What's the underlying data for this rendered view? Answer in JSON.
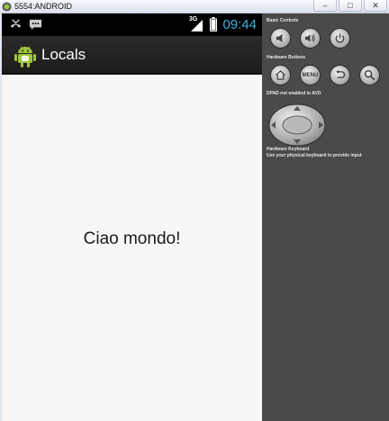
{
  "window": {
    "title": "5554:ANDROID",
    "buttons": {
      "minimize": "–",
      "maximize": "□",
      "close": "✕"
    }
  },
  "statusbar": {
    "network": "3G",
    "time": "09:44",
    "clock_color": "#35b5e5",
    "notifications": [
      "missed-call-icon",
      "message-icon"
    ]
  },
  "actionbar": {
    "title": "Locals",
    "logo": "android-robot-icon"
  },
  "content": {
    "text": "Ciao mondo!"
  },
  "panel": {
    "basic_controls": "Basic Controls",
    "hardware_buttons": "Hardware Buttons",
    "menu_label": "MENU",
    "dpad_note": "DPAD not enabled in AVD",
    "keyboard_title": "Hardware Keyboard",
    "keyboard_note": "Use your physical keyboard to provide input"
  }
}
